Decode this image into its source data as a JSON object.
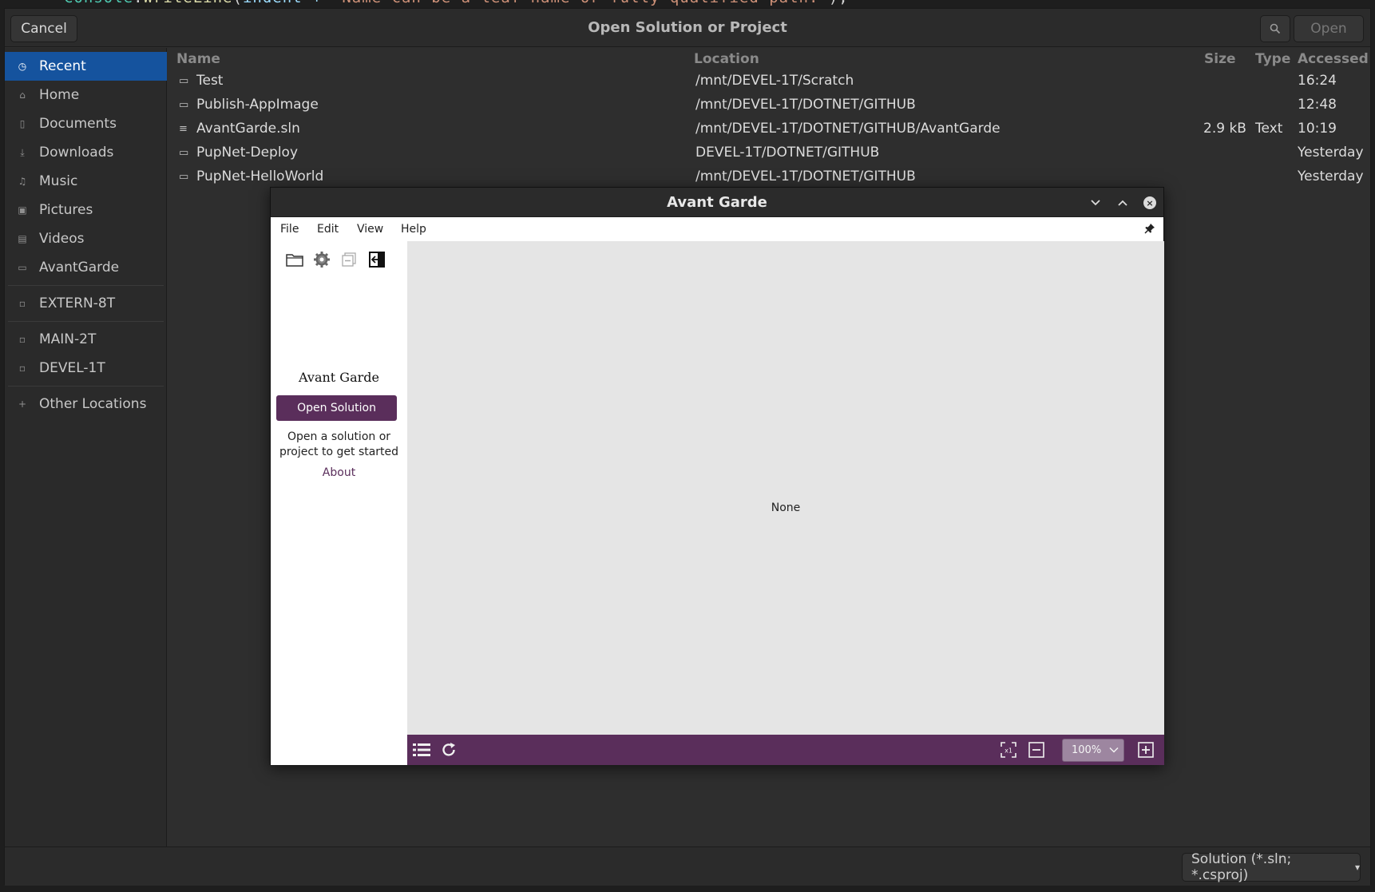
{
  "background_editor": {
    "code_parts": [
      "Console",
      ".",
      "WriteLine",
      "(",
      "indent + ",
      "\"Name can be a leaf name or fully qualified path.\"",
      ");"
    ]
  },
  "dialog": {
    "title": "Open Solution or Project",
    "cancel_label": "Cancel",
    "open_label": "Open",
    "search_icon": "search-icon",
    "sidebar": [
      {
        "label": "Recent",
        "icon": "clock-icon",
        "active": true
      },
      {
        "label": "Home",
        "icon": "home-icon"
      },
      {
        "label": "Documents",
        "icon": "document-icon"
      },
      {
        "label": "Downloads",
        "icon": "download-icon"
      },
      {
        "label": "Music",
        "icon": "music-icon"
      },
      {
        "label": "Pictures",
        "icon": "picture-icon"
      },
      {
        "label": "Videos",
        "icon": "video-icon"
      },
      {
        "label": "AvantGarde",
        "icon": "folder-icon"
      },
      {
        "label": "EXTERN-8T",
        "icon": "drive-icon"
      },
      {
        "label": "MAIN-2T",
        "icon": "drive-icon"
      },
      {
        "label": "DEVEL-1T",
        "icon": "drive-icon"
      },
      {
        "label": "Other Locations",
        "icon": "plus-icon"
      }
    ],
    "columns": {
      "name": "Name",
      "location": "Location",
      "size": "Size",
      "type": "Type",
      "accessed": "Accessed"
    },
    "rows": [
      {
        "name": "Test",
        "location": "/mnt/DEVEL-1T/Scratch",
        "size": "",
        "type": "",
        "accessed": "16:24",
        "icon": "folder-icon"
      },
      {
        "name": "Publish-AppImage",
        "location": "/mnt/DEVEL-1T/DOTNET/GITHUB",
        "size": "",
        "type": "",
        "accessed": "12:48",
        "icon": "folder-icon"
      },
      {
        "name": "AvantGarde.sln",
        "location": "/mnt/DEVEL-1T/DOTNET/GITHUB/AvantGarde",
        "size": "2.9 kB",
        "type": "Text",
        "accessed": "10:19",
        "icon": "text-file-icon"
      },
      {
        "name": "PupNet-Deploy",
        "location": "DEVEL-1T/DOTNET/GITHUB",
        "size": "",
        "type": "",
        "accessed": "Yesterday",
        "icon": "folder-icon"
      },
      {
        "name": "PupNet-HelloWorld",
        "location": "/mnt/DEVEL-1T/DOTNET/GITHUB",
        "size": "",
        "type": "",
        "accessed": "Yesterday",
        "icon": "folder-icon"
      }
    ],
    "filter_label": "Solution (*.sln; *.csproj)"
  },
  "avant_garde": {
    "title": "Avant Garde",
    "menu": [
      "File",
      "Edit",
      "View",
      "Help"
    ],
    "app_name": "Avant Garde",
    "open_solution_label": "Open Solution",
    "hint_line1": "Open a solution or",
    "hint_line2": "project to get started",
    "about_label": "About",
    "preview_text": "None",
    "zoom_value": "100%",
    "accent_color": "#5a2e5b"
  }
}
